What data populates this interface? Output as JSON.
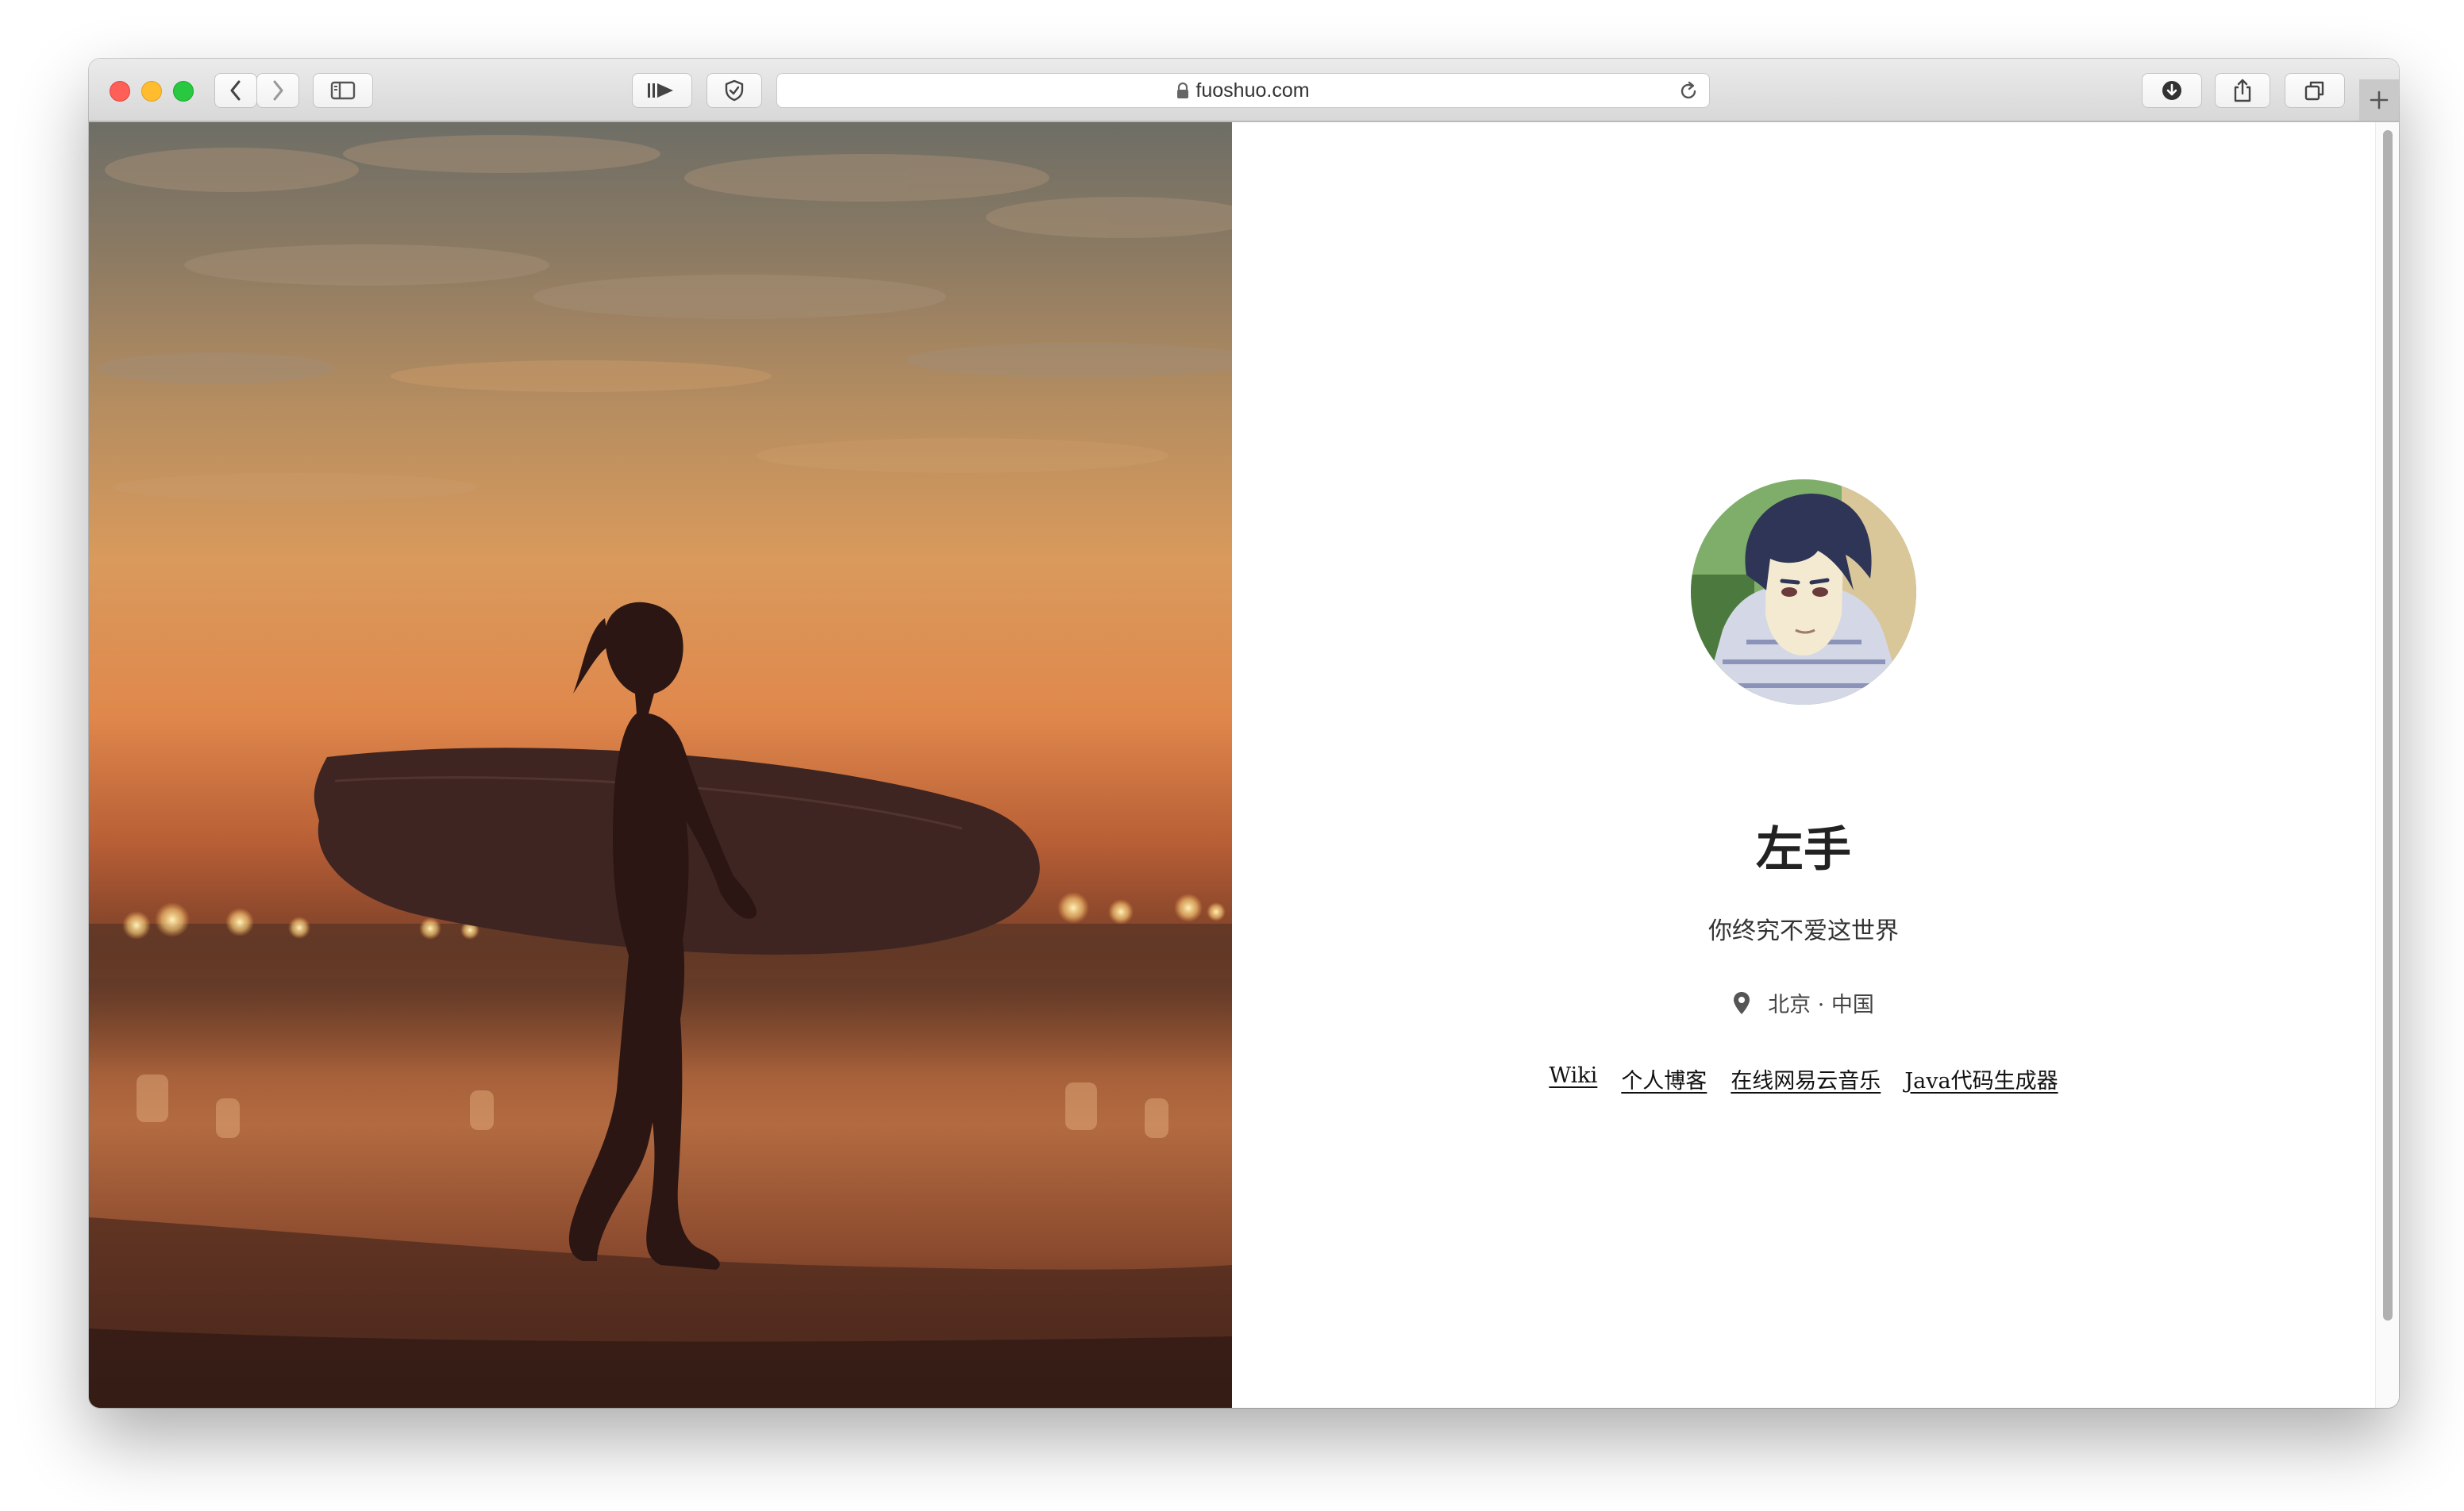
{
  "browser": {
    "url": "fuoshuo.com",
    "icons": [
      "close-icon",
      "minimize-icon",
      "zoom-icon",
      "back-icon",
      "forward-icon",
      "sidebar-icon",
      "reader-icon",
      "shield-icon",
      "lock-icon",
      "reload-icon",
      "download-icon",
      "share-icon",
      "tabs-overview-icon",
      "plus-icon"
    ]
  },
  "profile": {
    "name": "左手",
    "bio": "你终究不爱这世界",
    "location": "北京 · 中国",
    "links": [
      "Wiki",
      "个人博客",
      "在线网易云音乐",
      "Java代码生成器"
    ]
  }
}
